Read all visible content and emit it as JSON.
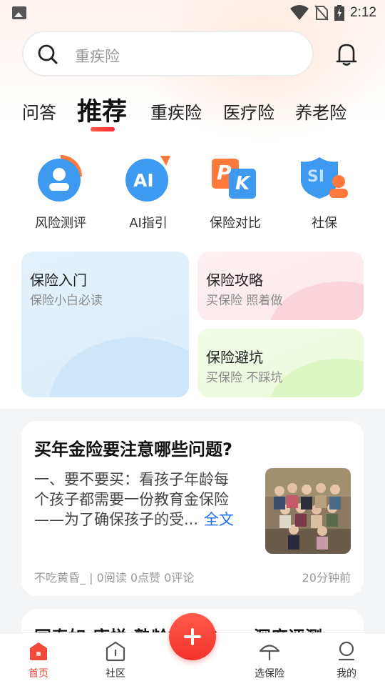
{
  "status_bar": {
    "time": "2:12"
  },
  "search": {
    "placeholder": "重疾险"
  },
  "tabs": [
    {
      "label": "问答"
    },
    {
      "label": "推荐",
      "active": true
    },
    {
      "label": "重疾险"
    },
    {
      "label": "医疗险"
    },
    {
      "label": "养老险"
    }
  ],
  "quick_actions": [
    {
      "label": "风险测评",
      "icon": "risk-assessment-icon"
    },
    {
      "label": "AI指引",
      "icon": "ai-guide-icon",
      "icon_text": "AI"
    },
    {
      "label": "保险对比",
      "icon": "pk-compare-icon",
      "icon_text_p": "P",
      "icon_text_k": "K"
    },
    {
      "label": "社保",
      "icon": "social-security-icon",
      "icon_text": "SI"
    }
  ],
  "cards": {
    "intro": {
      "title": "保险入门",
      "subtitle": "保险小白必读"
    },
    "guide": {
      "title": "保险攻略",
      "subtitle": "买保险 照着做"
    },
    "pitfall": {
      "title": "保险避坑",
      "subtitle": "买保险 不踩坑"
    }
  },
  "article": {
    "title": "买年金险要注意哪些问题?",
    "body": "一、要不要买：看孩子年龄每个孩子都需要一份教育金保险——为了确保孩子的受...",
    "more": "全文",
    "meta": "不吃黄昏_ | 0阅读 0点赞 0评论",
    "time": "20分钟前"
  },
  "article2": {
    "title": "国泰如-康悦-熟龄重疾险——深度评测"
  },
  "bottom_nav": [
    {
      "label": "首页",
      "icon": "home-icon",
      "active": true
    },
    {
      "label": "社区",
      "icon": "community-icon"
    },
    {
      "label": "选保险",
      "icon": "umbrella-icon"
    },
    {
      "label": "我的",
      "icon": "profile-icon"
    }
  ],
  "colors": {
    "accent": "#f04a3a",
    "link": "#1b6ef0",
    "icon_blue": "#3d9af0",
    "icon_orange": "#ff7a3a"
  }
}
